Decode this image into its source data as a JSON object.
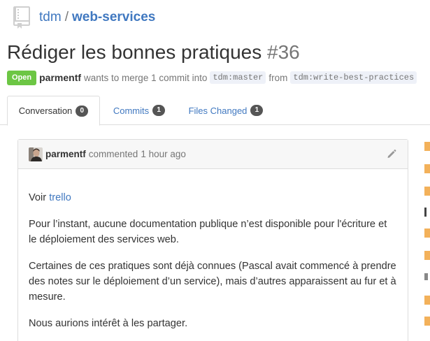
{
  "repo": {
    "owner": "tdm",
    "separator": "/",
    "name": "web-services"
  },
  "pull_request": {
    "title": "Rédiger les bonnes pratiques",
    "number": "#36",
    "state": "Open",
    "author": "parmentf",
    "action_text": "wants to merge 1 commit into",
    "base_branch": "tdm:master",
    "from_text": "from",
    "head_branch": "tdm:write-best-practices"
  },
  "tabs": [
    {
      "label": "Conversation",
      "count": "0",
      "selected": true
    },
    {
      "label": "Commits",
      "count": "1",
      "selected": false
    },
    {
      "label": "Files Changed",
      "count": "1",
      "selected": false
    }
  ],
  "comment": {
    "author": "parmentf",
    "action": "commented",
    "time": "1 hour ago",
    "body": {
      "p1_prefix": "Voir ",
      "p1_link": "trello",
      "p2": "Pour l’instant, aucune documentation publique n’est disponible pour l'écriture et le déploiement des services web.",
      "p3": "Certaines de ces pratiques sont déjà connues (Pascal avait commencé à prendre des notes sur le déploiement d’un service), mais d’autres apparaissent au fur et à mesure.",
      "p4": "Nous aurions intérêt à les partager."
    }
  },
  "colors": {
    "link": "#4078c0",
    "open_badge": "#6cc644",
    "counter": "#555555",
    "side_accent": "#f0a030"
  },
  "icons": {
    "repo": "repo-icon",
    "edit": "pencil-icon",
    "avatar": "avatar"
  }
}
